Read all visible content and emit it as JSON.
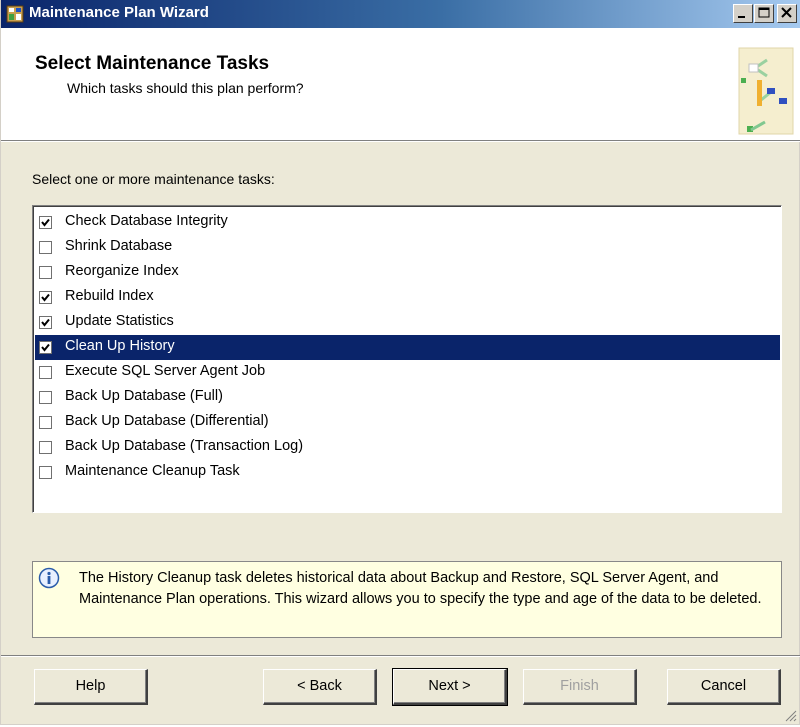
{
  "window": {
    "title": "Maintenance Plan Wizard",
    "title_icon": "wizard-app-icon",
    "controls": [
      "minimize-icon",
      "maximize-icon",
      "close-icon"
    ]
  },
  "header": {
    "title": "Select Maintenance Tasks",
    "subtitle": "Which tasks should this plan perform?",
    "graphic": "maintenance-plan-graphic"
  },
  "prompt": "Select one or more maintenance tasks:",
  "tasks": [
    {
      "label": "Check Database Integrity",
      "checked": true,
      "selected": false
    },
    {
      "label": "Shrink Database",
      "checked": false,
      "selected": false
    },
    {
      "label": "Reorganize Index",
      "checked": false,
      "selected": false
    },
    {
      "label": "Rebuild Index",
      "checked": true,
      "selected": false
    },
    {
      "label": "Update Statistics",
      "checked": true,
      "selected": false
    },
    {
      "label": "Clean Up History",
      "checked": true,
      "selected": true
    },
    {
      "label": "Execute SQL Server Agent Job",
      "checked": false,
      "selected": false
    },
    {
      "label": "Back Up Database (Full)",
      "checked": false,
      "selected": false
    },
    {
      "label": "Back Up Database (Differential)",
      "checked": false,
      "selected": false
    },
    {
      "label": "Back Up Database (Transaction Log)",
      "checked": false,
      "selected": false
    },
    {
      "label": "Maintenance Cleanup Task",
      "checked": false,
      "selected": false
    }
  ],
  "info": {
    "icon": "info-icon",
    "text": "The History Cleanup task deletes historical data about Backup and Restore, SQL Server Agent, and Maintenance Plan operations.  This wizard allows you to specify the type and age of the data to be deleted."
  },
  "buttons": {
    "help": "Help",
    "back": "< Back",
    "next": "Next >",
    "finish": "Finish",
    "cancel": "Cancel"
  },
  "colors": {
    "selection": "#0a246a",
    "info_background": "#ffffe1",
    "dialog_background": "#ece9d8"
  }
}
